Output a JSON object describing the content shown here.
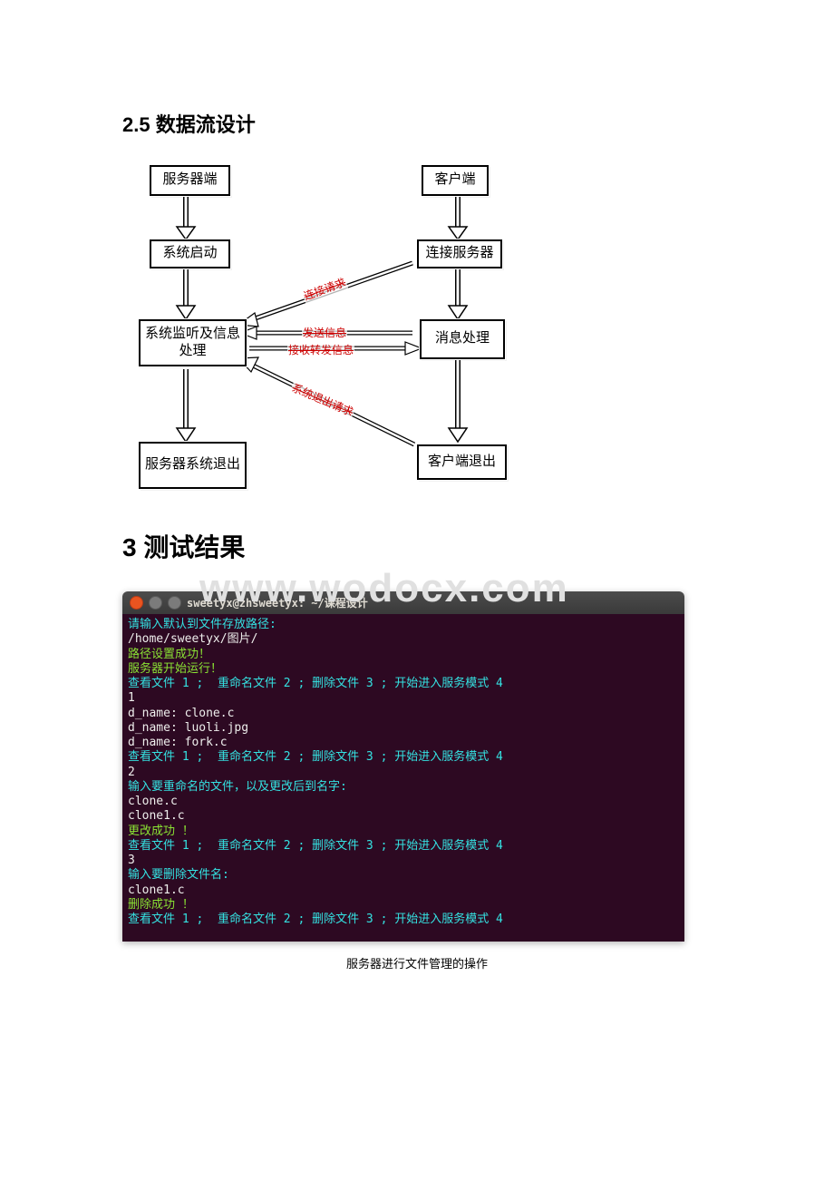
{
  "section_25_heading": "2.5 数据流设计",
  "section_3_heading": "3 测试结果",
  "watermark": "www.wodocx.com",
  "diagram": {
    "boxes": {
      "server_side": "服务器端",
      "client_side": "客户端",
      "system_start": "系统启动",
      "connect_server": "连接服务器",
      "listen_process": "系统监听及信息处理",
      "message_process": "消息处理",
      "server_exit": "服务器系统退出",
      "client_exit": "客户端退出"
    },
    "arrow_labels": {
      "connect_request": "连接请求",
      "send_info": "发送信息",
      "recv_forward": "接收转发信息",
      "system_exit_request": "系统退出请求"
    }
  },
  "terminal": {
    "title": "sweetyx@zhsweetyx: ~/课程设计",
    "lines": [
      {
        "cls": "c-cyan",
        "t": "请输入默认到文件存放路径:"
      },
      {
        "cls": "c-white",
        "t": "/home/sweetyx/图片/"
      },
      {
        "cls": "c-green",
        "t": "路径设置成功！"
      },
      {
        "cls": "c-green",
        "t": "服务器开始运行！"
      },
      {
        "cls": "c-cyan",
        "t": "查看文件 1 ;  重命名文件 2 ; 删除文件 3 ; 开始进入服务模式 4"
      },
      {
        "cls": "c-white",
        "t": "1"
      },
      {
        "cls": "c-white",
        "t": "d_name: clone.c"
      },
      {
        "cls": "c-white",
        "t": "d_name: luoli.jpg"
      },
      {
        "cls": "c-white",
        "t": "d_name: fork.c"
      },
      {
        "cls": "c-cyan",
        "t": "查看文件 1 ;  重命名文件 2 ; 删除文件 3 ; 开始进入服务模式 4"
      },
      {
        "cls": "c-white",
        "t": ""
      },
      {
        "cls": "c-white",
        "t": "2"
      },
      {
        "cls": "c-cyan",
        "t": "输入要重命名的文件，以及更改后到名字:"
      },
      {
        "cls": "c-white",
        "t": "clone.c"
      },
      {
        "cls": "c-white",
        "t": "clone1.c"
      },
      {
        "cls": "c-green",
        "t": "更改成功 ！"
      },
      {
        "cls": "c-cyan",
        "t": "查看文件 1 ;  重命名文件 2 ; 删除文件 3 ; 开始进入服务模式 4"
      },
      {
        "cls": "c-white",
        "t": ""
      },
      {
        "cls": "c-white",
        "t": "3"
      },
      {
        "cls": "c-cyan",
        "t": "输入要删除文件名:"
      },
      {
        "cls": "c-white",
        "t": "clone1.c"
      },
      {
        "cls": "c-green",
        "t": "删除成功 ！"
      },
      {
        "cls": "c-cyan",
        "t": "查看文件 1 ;  重命名文件 2 ; 删除文件 3 ; 开始进入服务模式 4"
      }
    ]
  },
  "caption": "服务器进行文件管理的操作"
}
